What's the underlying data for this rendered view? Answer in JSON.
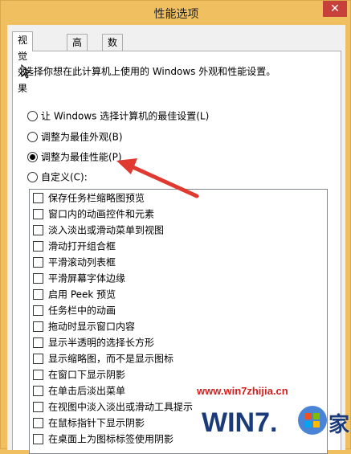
{
  "window": {
    "title": "性能选项",
    "close_label": "✕"
  },
  "tabs": [
    {
      "label": "视觉效果",
      "active": true
    },
    {
      "label": "高级",
      "active": false
    },
    {
      "label": "数据执行保护",
      "active": false
    }
  ],
  "description": "选择你想在此计算机上使用的 Windows 外观和性能设置。",
  "radios": [
    {
      "label": "让 Windows 选择计算机的最佳设置(L)",
      "checked": false
    },
    {
      "label": "调整为最佳外观(B)",
      "checked": false
    },
    {
      "label": "调整为最佳性能(P)",
      "checked": true
    },
    {
      "label": "自定义(C):",
      "checked": false
    }
  ],
  "effects": [
    "保存任务栏缩略图预览",
    "窗口内的动画控件和元素",
    "淡入淡出或滑动菜单到视图",
    "滑动打开组合框",
    "平滑滚动列表框",
    "平滑屏幕字体边缘",
    "启用 Peek 预览",
    "任务栏中的动画",
    "拖动时显示窗口内容",
    "显示半透明的选择长方形",
    "显示缩略图，而不是显示图标",
    "在窗口下显示阴影",
    "在单击后淡出菜单",
    "在视图中淡入淡出或滑动工具提示",
    "在鼠标指针下显示阴影",
    "在桌面上为图标标签使用阴影"
  ],
  "watermark": {
    "url": "www.win7zhijia.cn",
    "logo_text": "WIN7.",
    "logo_char": "家"
  },
  "colors": {
    "accent_arrow": "#e0392f",
    "close": "#c7413b",
    "frame": "#f0c060"
  }
}
